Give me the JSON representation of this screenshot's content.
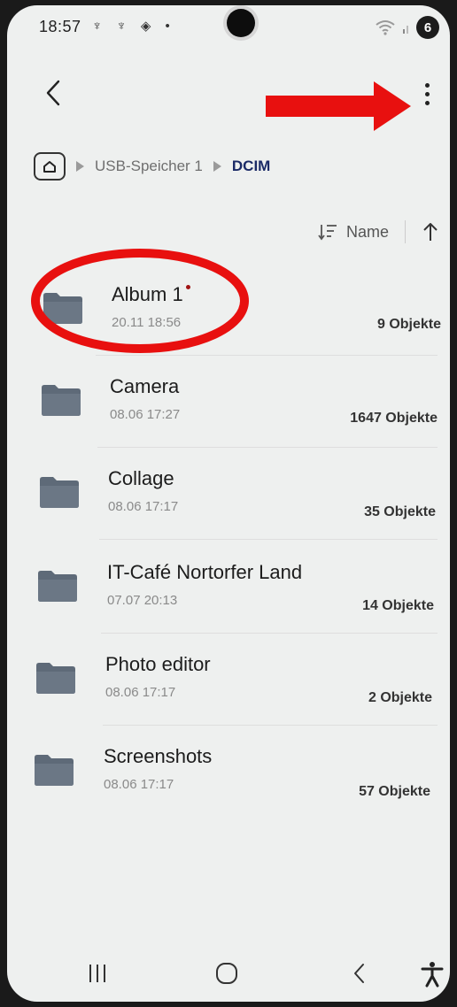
{
  "status_bar": {
    "time": "18:57",
    "left_icons": "♆ ♆ ◈ •",
    "battery_badge": "6",
    "icons": [
      "usb-icon",
      "usb-icon",
      "location-icon",
      "wifi-icon",
      "signal-icon"
    ]
  },
  "toolbar": {
    "back_icon": "chevron-left-icon",
    "more_icon": "more-vertical-icon"
  },
  "breadcrumb": {
    "home_icon": "home-icon",
    "items": [
      "USB-Speicher 1",
      "DCIM"
    ]
  },
  "sort": {
    "label": "Name",
    "sort_icon": "sort-list-icon",
    "direction_icon": "arrow-up-icon"
  },
  "folders": [
    {
      "name": "Album 1",
      "date": "20.11 18:56",
      "count": "9 Objekte",
      "new": true
    },
    {
      "name": "Camera",
      "date": "08.06 17:27",
      "count": "1647 Objekte"
    },
    {
      "name": "Collage",
      "date": "08.06 17:17",
      "count": "35 Objekte"
    },
    {
      "name": "IT-Café Nortorfer Land",
      "date": "07.07 20:13",
      "count": "14 Objekte"
    },
    {
      "name": "Photo editor",
      "date": "08.06 17:17",
      "count": "2 Objekte"
    },
    {
      "name": "Screenshots",
      "date": "08.06 17:17",
      "count": "57 Objekte"
    }
  ],
  "nav_bar": {
    "items": [
      "recent-apps-icon",
      "home-icon",
      "back-icon",
      "accessibility-icon"
    ]
  },
  "colors": {
    "background": "#eef0ef",
    "annotation_red": "#e8100f",
    "folder_icon": "#6b7785",
    "breadcrumb_current": "#1a2a66"
  }
}
